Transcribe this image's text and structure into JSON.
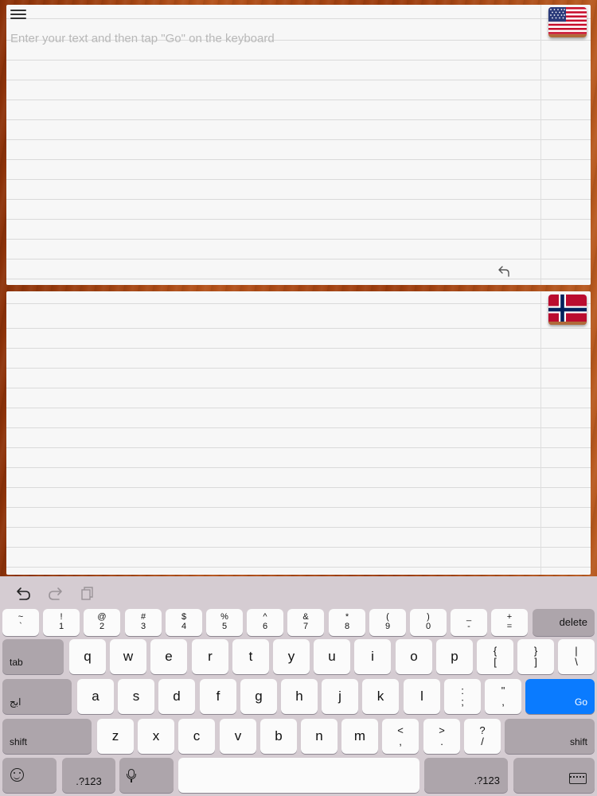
{
  "input": {
    "placeholder": "Enter your text and then tap \"Go\" on the keyboard",
    "value": ""
  },
  "flags": {
    "source": "us-flag-icon",
    "target": "norway-flag-icon"
  },
  "keyboard": {
    "number_row": [
      {
        "top": "~",
        "bottom": "`"
      },
      {
        "top": "!",
        "bottom": "1"
      },
      {
        "top": "@",
        "bottom": "2"
      },
      {
        "top": "#",
        "bottom": "3"
      },
      {
        "top": "$",
        "bottom": "4"
      },
      {
        "top": "%",
        "bottom": "5"
      },
      {
        "top": "^",
        "bottom": "6"
      },
      {
        "top": "&",
        "bottom": "7"
      },
      {
        "top": "*",
        "bottom": "8"
      },
      {
        "top": "(",
        "bottom": "9"
      },
      {
        "top": ")",
        "bottom": "0"
      },
      {
        "top": "_",
        "bottom": "-"
      },
      {
        "top": "+",
        "bottom": "="
      }
    ],
    "delete_label": "delete",
    "tab_label": "tab",
    "row_q": [
      "q",
      "w",
      "e",
      "r",
      "t",
      "y",
      "u",
      "i",
      "o",
      "p"
    ],
    "row_q_symbols": [
      {
        "top": "{",
        "bottom": "["
      },
      {
        "top": "}",
        "bottom": "]"
      },
      {
        "top": "|",
        "bottom": "\\"
      }
    ],
    "lang_label": "ابج",
    "row_a": [
      "a",
      "s",
      "d",
      "f",
      "g",
      "h",
      "j",
      "k",
      "l"
    ],
    "row_a_symbols": [
      {
        "top": ":",
        "bottom": ";"
      },
      {
        "top": "\"",
        "bottom": ","
      }
    ],
    "go_label": "Go",
    "shift_label": "shift",
    "row_z": [
      "z",
      "x",
      "c",
      "v",
      "b",
      "n",
      "m"
    ],
    "row_z_symbols": [
      {
        "top": "<",
        "bottom": ","
      },
      {
        "top": ">",
        "bottom": "."
      },
      {
        "top": "?",
        "bottom": "/"
      }
    ],
    "numbers_label": ".?123",
    "colors": {
      "key": "#fbfbfb",
      "dark_key": "#ada5ab",
      "go": "#0a7bff",
      "background": "#d5ccd2"
    }
  }
}
